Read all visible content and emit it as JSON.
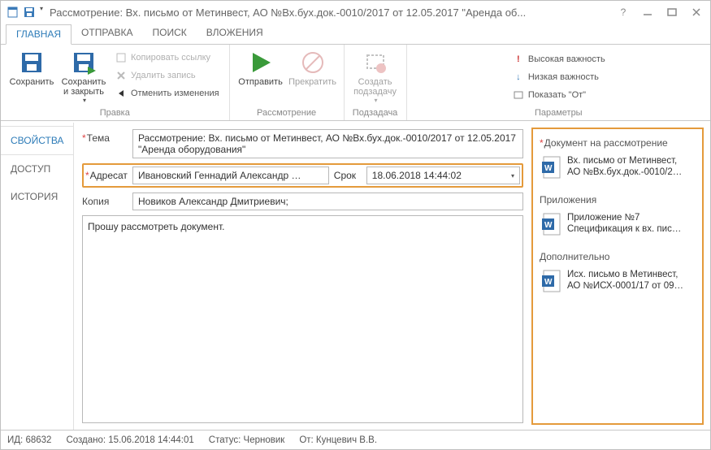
{
  "titlebar": {
    "title": "Рассмотрение: Вх. письмо от Метинвест, АО №Вх.бух.док.-0010/2017 от 12.05.2017 \"Аренда об..."
  },
  "tabs": {
    "main": "ГЛАВНАЯ",
    "send": "ОТПРАВКА",
    "search": "ПОИСК",
    "attach": "ВЛОЖЕНИЯ"
  },
  "ribbon": {
    "edit_group": "Правка",
    "save": "Сохранить",
    "save_close": "Сохранить\nи закрыть",
    "copy_link": "Копировать ссылку",
    "delete_rec": "Удалить запись",
    "cancel_changes": "Отменить изменения",
    "review_group": "Рассмотрение",
    "send_btn": "Отправить",
    "stop_btn": "Прекратить",
    "subtask_group": "Подзадача",
    "create_sub": "Создать\nподзадачу",
    "params_group": "Параметры",
    "high": "Высокая важность",
    "low": "Низкая важность",
    "show_from": "Показать \"От\""
  },
  "sidetabs": {
    "props": "СВОЙСТВА",
    "access": "ДОСТУП",
    "history": "ИСТОРИЯ"
  },
  "form": {
    "theme_label": "Тема",
    "theme_value": "Рассмотрение: Вх. письмо от Метинвест, АО №Вх.бух.док.-0010/2017 от 12.05.2017 \"Аренда оборудования\"",
    "addr_label": "Адресат",
    "addr_value": "Ивановский Геннадий Александр …",
    "deadline_label": "Срок",
    "deadline_value": "18.06.2018 14:44:02",
    "copy_label": "Копия",
    "copy_value": "Новиков Александр Дмитриевич;",
    "body_text": "Прошу рассмотреть документ."
  },
  "rightpane": {
    "doc_review_head": "Документ на рассмотрение",
    "doc1_l1": "Вх. письмо от Метинвест,",
    "doc1_l2": "АО №Вх.бух.док.-0010/2…",
    "apps_head": "Приложения",
    "doc2_l1": "Приложение №7",
    "doc2_l2": "Спецификация к вх. пис…",
    "extra_head": "Дополнительно",
    "doc3_l1": "Исх. письмо в Метинвест,",
    "doc3_l2": "АО №ИСХ-0001/17 от 09…"
  },
  "status": {
    "id": "ИД: 68632",
    "created": "Создано: 15.06.2018 14:44:01",
    "status": "Статус: Черновик",
    "from": "От: Кунцевич В.В."
  }
}
